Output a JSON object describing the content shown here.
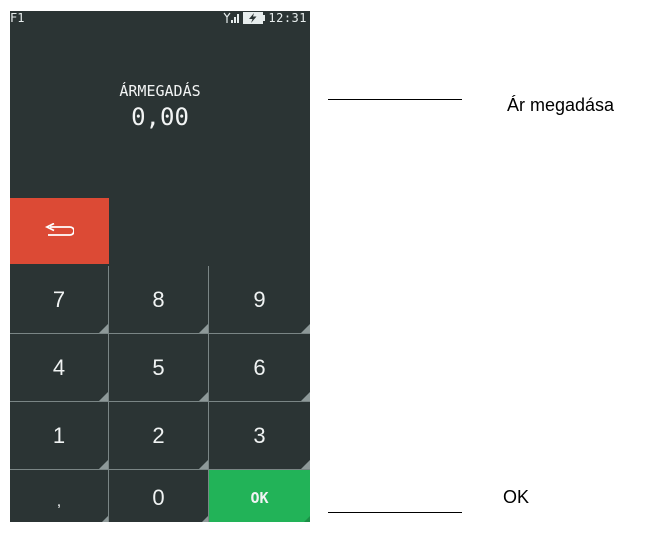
{
  "statusbar": {
    "function_key": "F1",
    "time": "12:31",
    "signal_icon": "signal-antenna-icon",
    "battery_icon": "battery-charging-icon"
  },
  "screen": {
    "title": "ÁRMEGADÁS",
    "amount": "0,00"
  },
  "keys": {
    "back_icon": "return-arrow-icon",
    "k7": "7",
    "k8": "8",
    "k9": "9",
    "k4": "4",
    "k5": "5",
    "k6": "6",
    "k1": "1",
    "k2": "2",
    "k3": "3",
    "comma": ",",
    "k0": "0",
    "ok": "OK"
  },
  "callouts": {
    "price_entry": "Ár megadása",
    "ok": "OK"
  },
  "colors": {
    "screen_bg": "#2b3434",
    "back_key": "#dc4a35",
    "ok_key": "#22b358"
  }
}
